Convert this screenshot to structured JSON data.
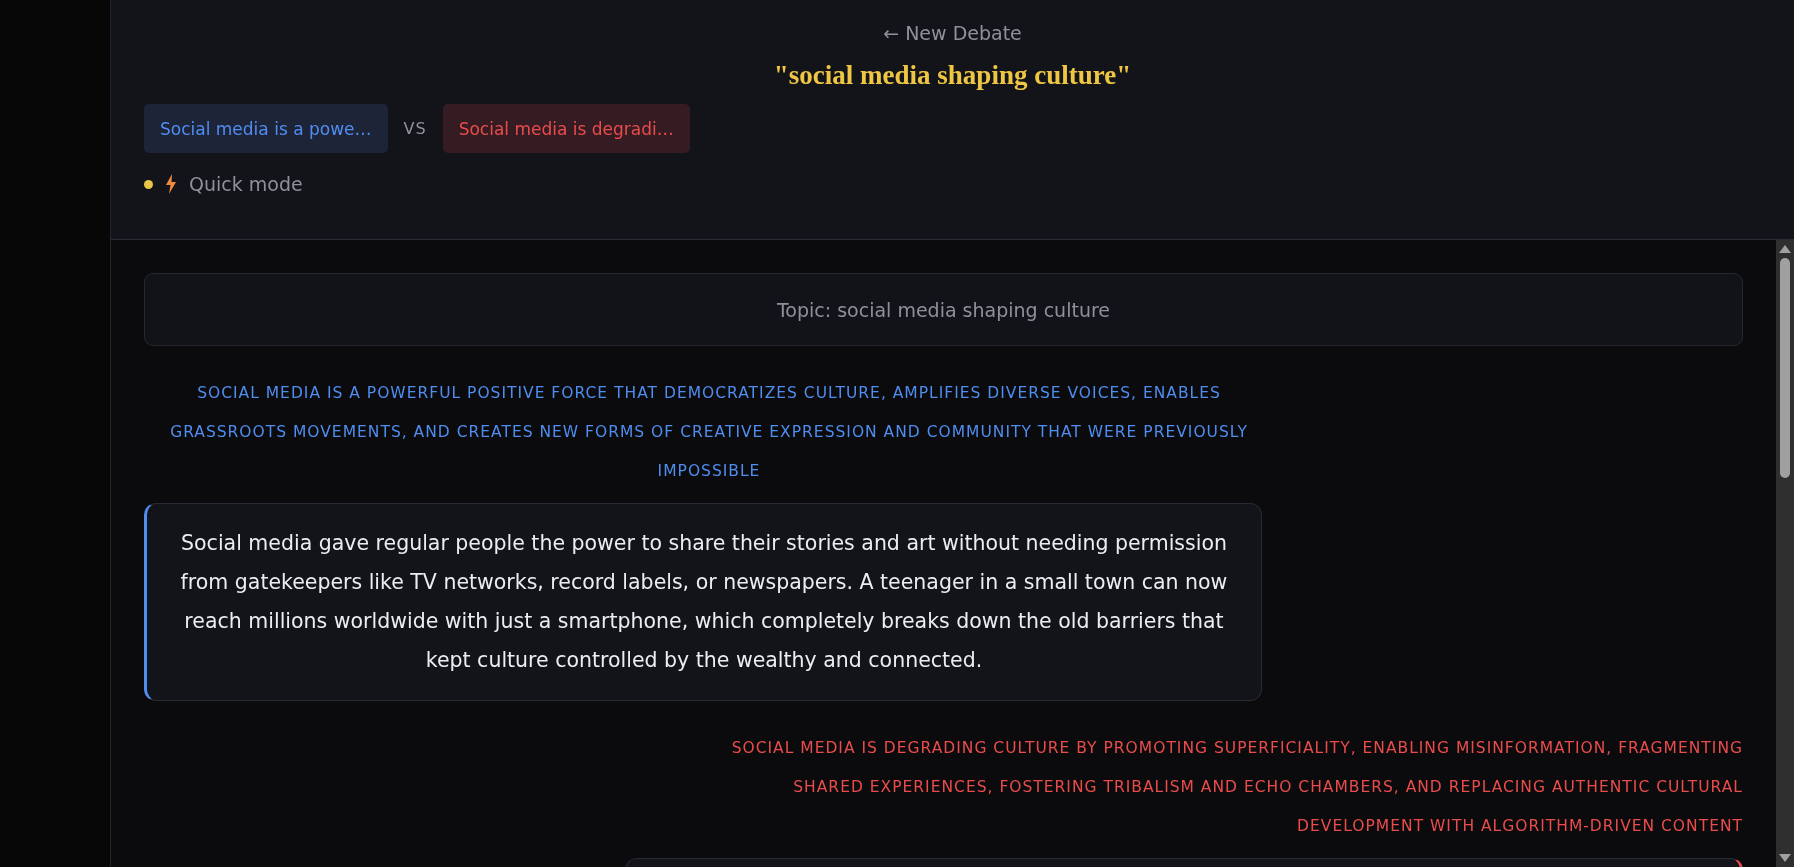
{
  "header": {
    "back_link": "← New Debate",
    "title": "\"social media shaping culture\"",
    "sides": [
      {
        "label": "Social media is a powe…",
        "kind": "pro"
      },
      {
        "label": "Social media is degradi…",
        "kind": "con"
      }
    ],
    "versus": "VS",
    "mode": {
      "label": "Quick mode",
      "color": "#e8c547"
    }
  },
  "main": {
    "topic": "Topic: social media shaping culture",
    "turns": [
      {
        "kind": "pro",
        "position": "SOCIAL MEDIA IS A POWERFUL POSITIVE FORCE THAT DEMOCRATIZES CULTURE, AMPLIFIES DIVERSE VOICES, ENABLES GRASSROOTS MOVEMENTS, AND CREATES NEW FORMS OF CREATIVE EXPRESSION AND COMMUNITY THAT WERE PREVIOUSLY IMPOSSIBLE",
        "argument": "Social media gave regular people the power to share their stories and art without needing permission from gatekeepers like TV networks, record labels, or newspapers. A teenager in a small town can now reach millions worldwide with just a smartphone, which completely breaks down the old barriers that kept culture controlled by the wealthy and connected."
      },
      {
        "kind": "con",
        "position": "SOCIAL MEDIA IS DEGRADING CULTURE BY PROMOTING SUPERFICIALITY, ENABLING MISINFORMATION, FRAGMENTING SHARED EXPERIENCES, FOSTERING TRIBALISM AND ECHO CHAMBERS, AND REPLACING AUTHENTIC CULTURAL DEVELOPMENT WITH ALGORITHM-DRIVEN CONTENT"
      }
    ]
  }
}
